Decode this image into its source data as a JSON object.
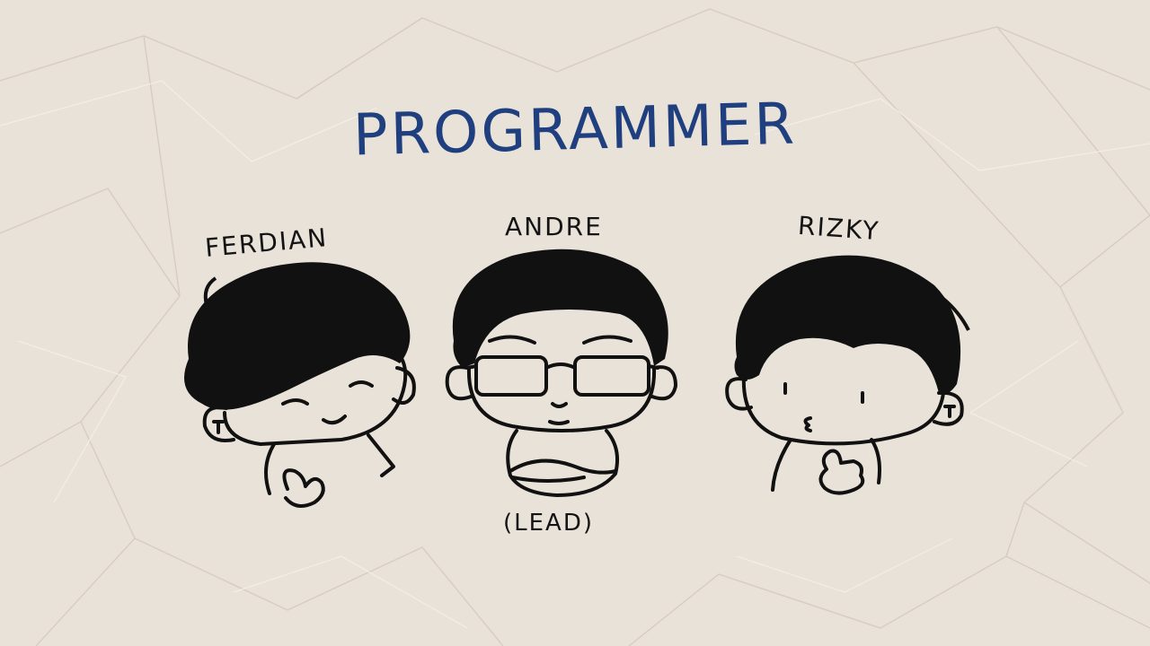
{
  "title": {
    "text": "PROGRAMMER",
    "color": "#1f3f7f"
  },
  "people": [
    {
      "name": "FERDIAN",
      "icon": "boy-peace-sign-illustration"
    },
    {
      "name": "ANDRE",
      "role": "(LEAD)",
      "icon": "boy-glasses-arms-crossed-illustration"
    },
    {
      "name": "RIZKY",
      "icon": "boy-thumbs-up-illustration"
    }
  ],
  "colors": {
    "paper": "#e9e2d8",
    "ink": "#111111",
    "title_ink": "#1f3f7f"
  }
}
